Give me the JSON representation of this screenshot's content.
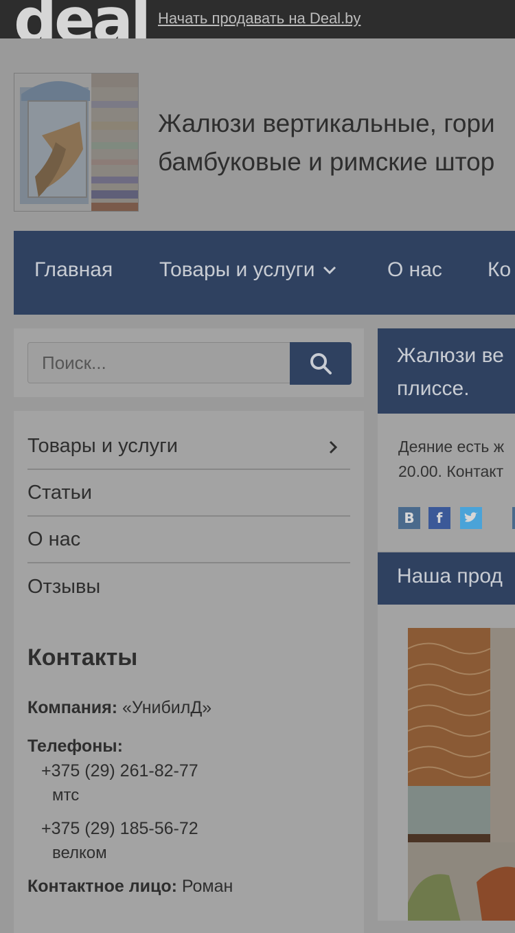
{
  "topbar": {
    "logo": "deal",
    "sell_link": "Начать продавать на Deal.by"
  },
  "header": {
    "title_line1": "Жалюзи вертикальные, гори",
    "title_line2": "бамбуковые и римские штор"
  },
  "nav": {
    "items": [
      {
        "label": "Главная"
      },
      {
        "label": "Товары и услуги"
      },
      {
        "label": "О нас"
      },
      {
        "label": "Ко"
      }
    ]
  },
  "search": {
    "placeholder": "Поиск..."
  },
  "sidebar": {
    "items": [
      {
        "label": "Товары и услуги"
      },
      {
        "label": "Статьи"
      },
      {
        "label": "О нас"
      },
      {
        "label": "Отзывы"
      }
    ]
  },
  "contacts": {
    "heading": "Контакты",
    "company_label": "Компания:",
    "company_value": "«УнибилД»",
    "phones_label": "Телефоны:",
    "phones": [
      {
        "number": "+375 (29) 261-82-77",
        "operator": "мтс"
      },
      {
        "number": "+375 (29) 185-56-72",
        "operator": "велком"
      }
    ],
    "person_label": "Контактное лицо:",
    "person_value": "Роман"
  },
  "main": {
    "heading_line1": "Жалюзи ве",
    "heading_line2": "плиссе.",
    "desc_line1": "Деяние есть ж",
    "desc_line2": "20.00. Контакт",
    "social": [
      {
        "label": "B",
        "color": "#4a6a8c"
      },
      {
        "label": "f",
        "color": "#3b5998"
      },
      {
        "label": "t",
        "color": "#4aa3d8"
      }
    ]
  },
  "products": {
    "heading": "Наша прод"
  }
}
